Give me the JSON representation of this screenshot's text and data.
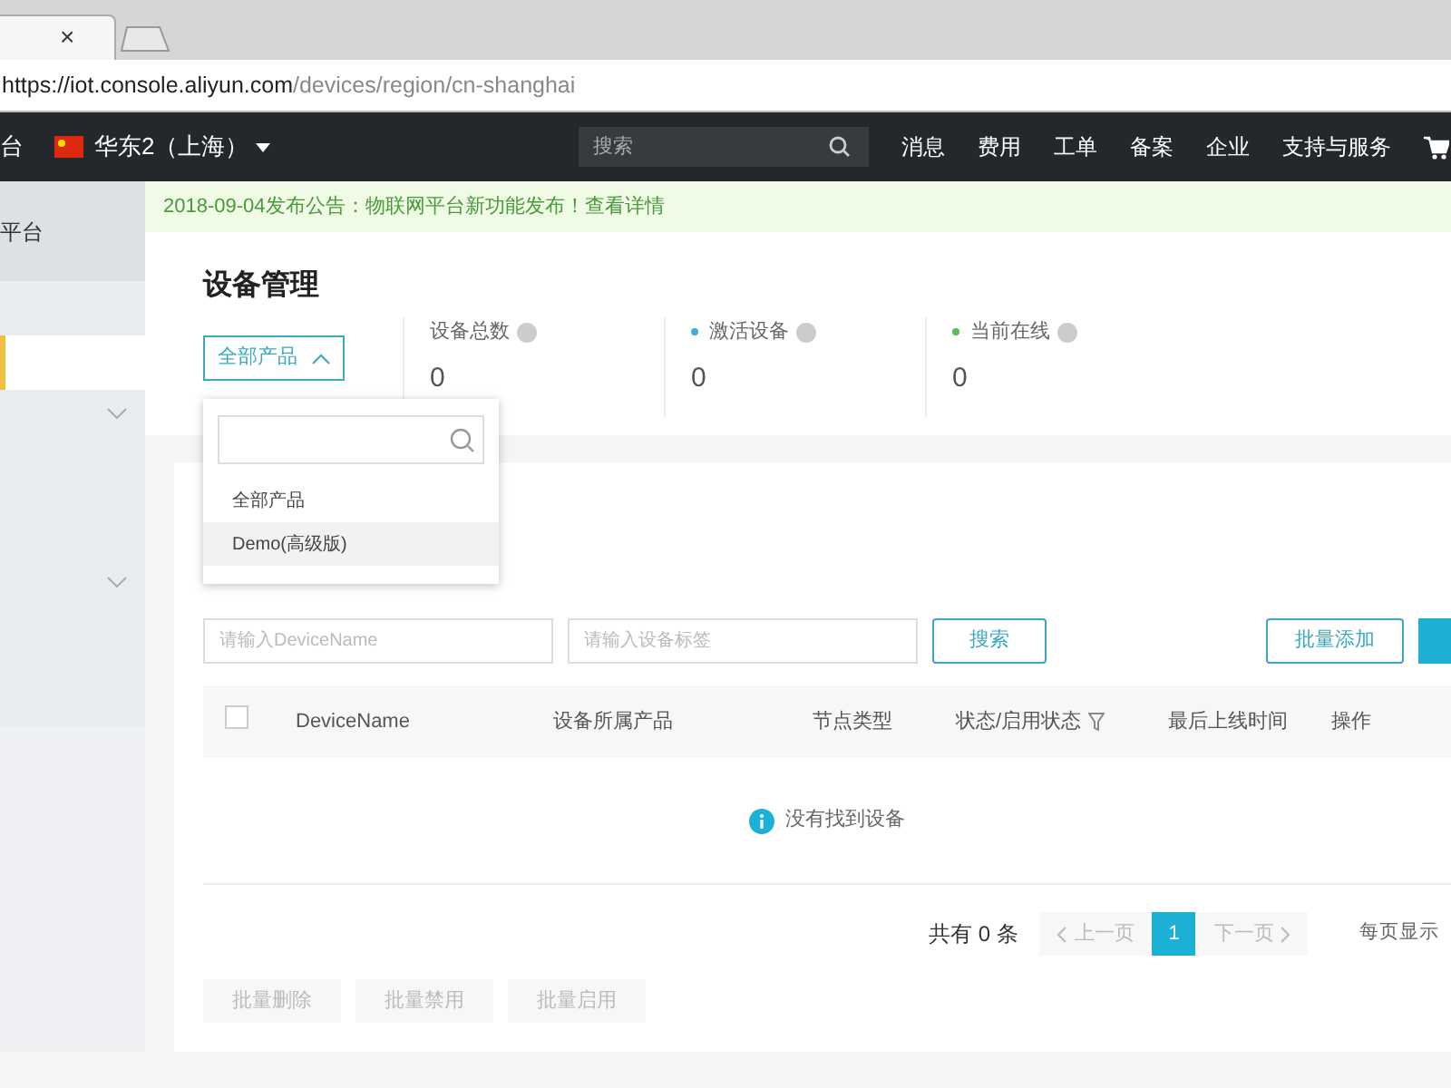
{
  "browser": {
    "tab_close": "×",
    "url_host": "https://iot.console.aliyun.com",
    "url_path": "/devices/region/cn-shanghai"
  },
  "navbar": {
    "brand": "台",
    "region": "华东2（上海）",
    "search_placeholder": "搜索",
    "links": [
      "消息",
      "费用",
      "工单",
      "备案",
      "企业",
      "支持与服务"
    ]
  },
  "sidebar": {
    "items": [
      {
        "label": "平台",
        "kind": "item",
        "selected": false
      },
      {
        "kind": "item",
        "selected": false
      },
      {
        "kind": "item",
        "selected": true
      },
      {
        "kind": "group",
        "selected": false
      },
      {
        "kind": "group",
        "selected": false
      }
    ]
  },
  "notice": {
    "text": "2018-09-04发布公告：物联网平台新功能发布！",
    "link": "查看详情"
  },
  "title": "设备管理",
  "product_select": {
    "value": "全部产品",
    "expanded": true,
    "options": [
      {
        "label": "全部产品",
        "highlighted": false
      },
      {
        "label": "Demo(高级版)",
        "highlighted": true
      }
    ]
  },
  "stats": [
    {
      "label": "设备总数",
      "value": "0"
    },
    {
      "label": "激活设备",
      "value": "0",
      "color": "#3ab0d8"
    },
    {
      "label": "当前在线",
      "value": "0",
      "color": "#5cb85c"
    }
  ],
  "filters": [
    {
      "placeholder": "请输入DeviceName"
    },
    {
      "placeholder": "请输入设备标签"
    }
  ],
  "search_button": "搜索",
  "batch_add_button": "批量添加",
  "table": {
    "columns": [
      "DeviceName",
      "设备所属产品",
      "节点类型",
      "状态/启用状态",
      "最后上线时间",
      "操作"
    ],
    "select_all_checked": false,
    "empty_message": "没有找到设备"
  },
  "pagination": {
    "total": "共有 0 条",
    "prev": "上一页",
    "next": "下一页",
    "pages": [
      {
        "label": "1",
        "selected": true
      }
    ],
    "page_size_label": "每页显示"
  },
  "bulk_actions": [
    {
      "label": "批量删除",
      "disabled": true
    },
    {
      "label": "批量禁用",
      "disabled": true
    },
    {
      "label": "批量启用",
      "disabled": true
    }
  ]
}
